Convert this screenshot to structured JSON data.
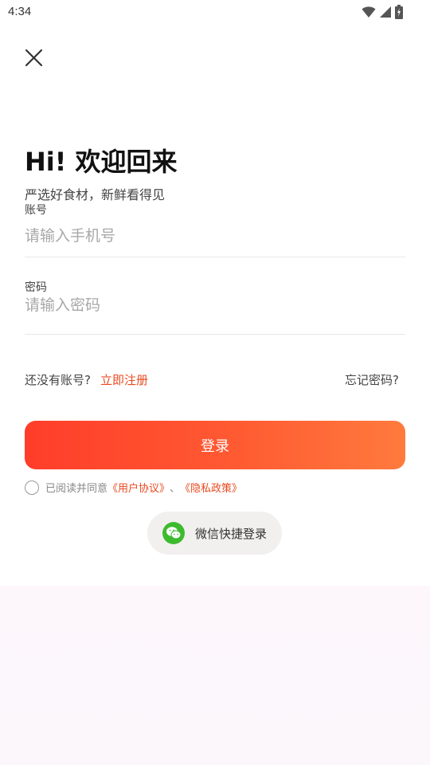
{
  "status_bar": {
    "time": "4:34"
  },
  "header": {
    "close_icon": "close-icon"
  },
  "title": "Hi! 欢迎回来",
  "subtitle": "严选好食材，新鲜看得见",
  "account": {
    "label": "账号",
    "placeholder": "请输入手机号",
    "value": ""
  },
  "password": {
    "label": "密码",
    "placeholder": "请输入密码",
    "value": ""
  },
  "register": {
    "prompt": "还没有账号?",
    "link": "立即注册"
  },
  "forgot_password": "忘记密码?",
  "login_button": "登录",
  "agreement": {
    "checked": false,
    "prefix": "已阅读并同意",
    "user_agreement": "《用户协议》",
    "separator": "、",
    "privacy_policy": "《隐私政策》"
  },
  "wechat_login": {
    "label": "微信快捷登录",
    "icon": "wechat-icon"
  },
  "colors": {
    "accent": "#e84a1f",
    "button_start": "#ff3d2a",
    "button_end": "#ff7a3d",
    "wechat_green": "#3dbb2f"
  }
}
